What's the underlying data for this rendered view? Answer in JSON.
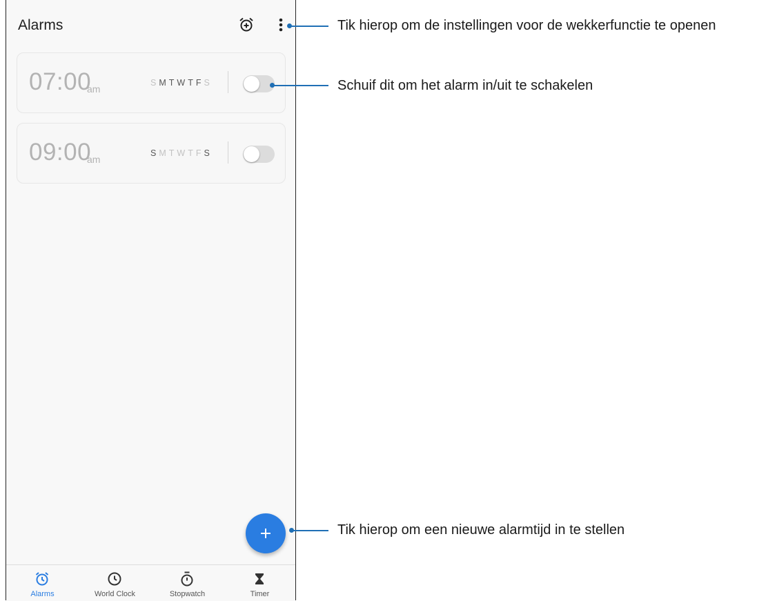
{
  "app": {
    "title": "Alarms"
  },
  "toolbar": {
    "bedtime_icon": "alarm-add-icon",
    "more_icon": "more-vertical-icon"
  },
  "alarms": [
    {
      "time": "07:00",
      "ampm": "am",
      "days": [
        "S",
        "M",
        "T",
        "W",
        "T",
        "F",
        "S"
      ],
      "active_days": [
        1,
        2,
        3,
        4,
        5
      ],
      "enabled": false
    },
    {
      "time": "09:00",
      "ampm": "am",
      "days": [
        "S",
        "M",
        "T",
        "W",
        "T",
        "F",
        "S"
      ],
      "active_days": [
        0,
        6
      ],
      "enabled": false
    }
  ],
  "fab": {
    "icon": "plus-icon"
  },
  "nav": [
    {
      "label": "Alarms",
      "icon": "alarm-clock-icon",
      "active": true
    },
    {
      "label": "World Clock",
      "icon": "clock-icon",
      "active": false
    },
    {
      "label": "Stopwatch",
      "icon": "stopwatch-icon",
      "active": false
    },
    {
      "label": "Timer",
      "icon": "hourglass-icon",
      "active": false
    }
  ],
  "callouts": {
    "settings": "Tik hierop om de instellingen voor de wekkerfunctie te openen",
    "toggle": "Schuif dit om het alarm in/uit te schakelen",
    "add": "Tik hierop om een nieuwe alarmtijd in te stellen"
  },
  "colors": {
    "accent": "#2a7de1",
    "callout": "#1f6fb5"
  }
}
